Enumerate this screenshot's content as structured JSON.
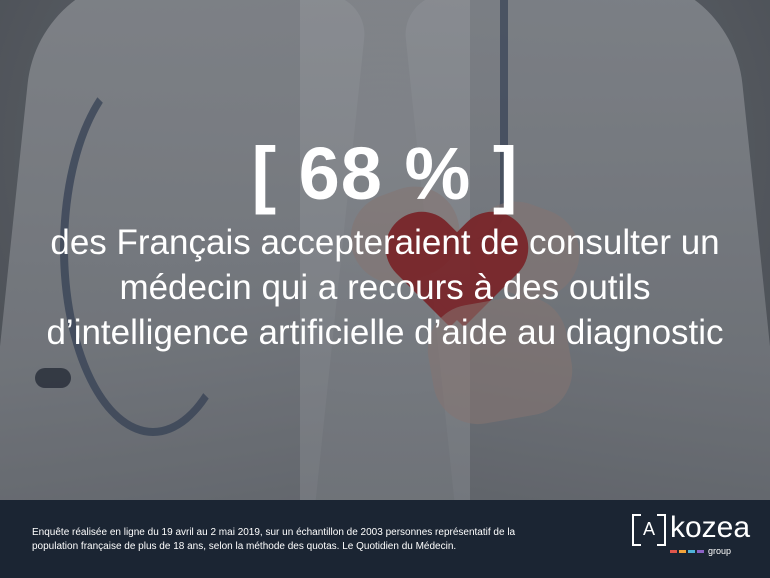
{
  "headline": {
    "stat": "[ 68 % ]",
    "description": "des Français accepteraient de consulter un médecin qui a recours à des outils d’intelligence artificielle d’aide au diagnostic"
  },
  "footer": {
    "source_line_1": "Enquête réalisée en ligne du 19 avril au 2 mai 2019, sur un échantillon de 2003 personnes représentatif de la",
    "source_line_2": "population française de plus de 18 ans, selon la méthode des quotas. Le Quotidien du Médecin."
  },
  "logo": {
    "mark_letter": "A",
    "wordmark": "kozea",
    "tagline": "group",
    "dot_colors": [
      "#e0564c",
      "#f2a33a",
      "#4fb3d9",
      "#8c63c7"
    ]
  },
  "colors": {
    "footer_background": "#1b2533",
    "text": "#ffffff",
    "heart": "#b31b1b"
  }
}
